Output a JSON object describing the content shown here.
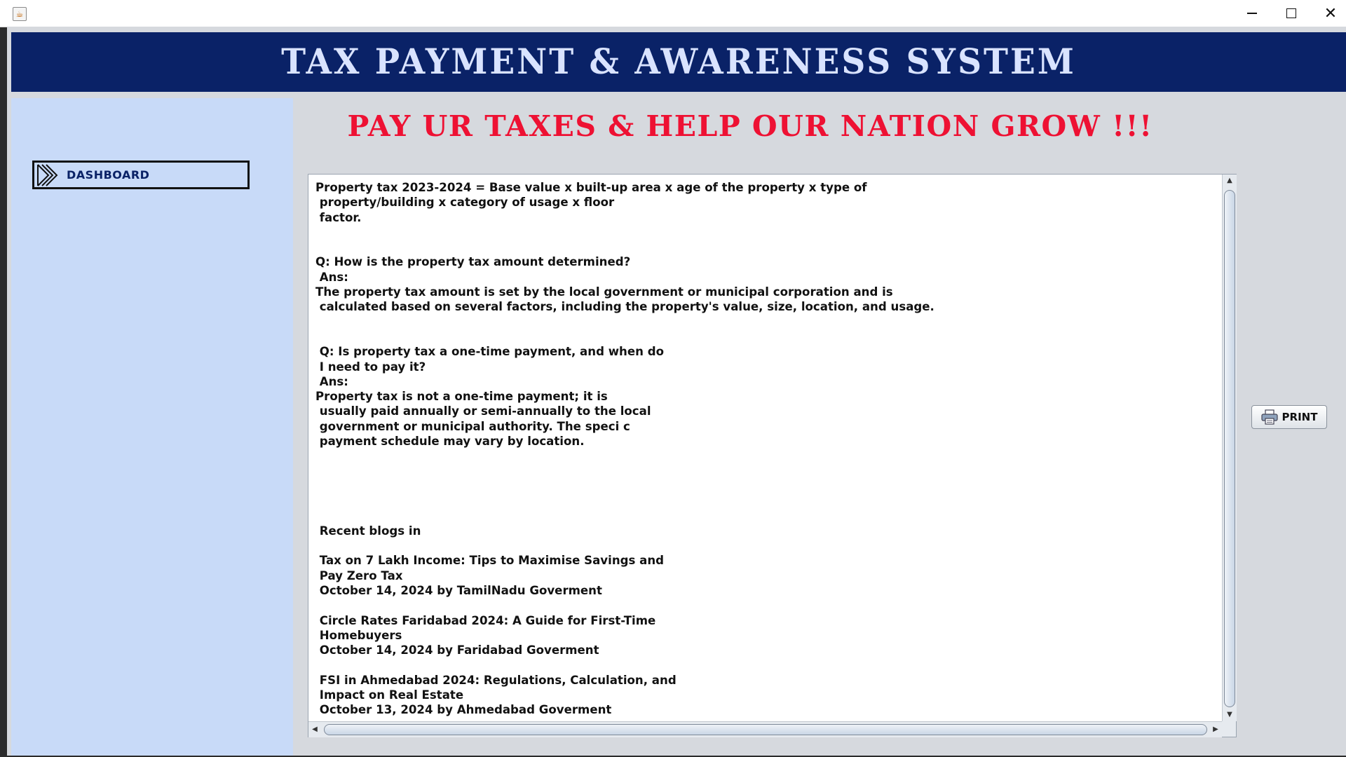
{
  "window": {
    "icon": "java-icon",
    "controls": {
      "minimize": "minimize-icon",
      "maximize": "maximize-icon",
      "close": "close-icon"
    }
  },
  "header": {
    "title": "TAX PAYMENT & AWARENESS SYSTEM"
  },
  "sidebar": {
    "dashboard_label": "DASHBOARD"
  },
  "main": {
    "slogan": "PAY UR TAXES & HELP OUR NATION GROW !!!",
    "content": "Property tax 2023-2024 = Base value x built-up area x age of the property x type of\n property/building x category of usage x floor\n factor.\n\n\nQ: How is the property tax amount determined?\n Ans:\nThe property tax amount is set by the local government or municipal corporation and is\n calculated based on several factors, including the property's value, size, location, and usage.\n\n\n Q: Is property tax a one-time payment, and when do\n I need to pay it?\n Ans:\nProperty tax is not a one-time payment; it is\n usually paid annually or semi-annually to the local\n government or municipal authority. The speci c\n payment schedule may vary by location.\n\n\n\n\n\n Recent blogs in\n\n Tax on 7 Lakh Income: Tips to Maximise Savings and\n Pay Zero Tax\n October 14, 2024 by TamilNadu Goverment\n\n Circle Rates Faridabad 2024: A Guide for First-Time\n Homebuyers\n October 14, 2024 by Faridabad Goverment\n\n FSI in Ahmedabad 2024: Regulations, Calculation, and\n Impact on Real Estate\n October 13, 2024 by Ahmedabad Goverment",
    "print_label": "PRINT"
  },
  "colors": {
    "header_bg": "#0a2267",
    "header_text": "#d9e3ff",
    "slogan": "#ee1133",
    "sidebar_bg": "#c8daf8",
    "panel_bg": "#d6d9de"
  }
}
